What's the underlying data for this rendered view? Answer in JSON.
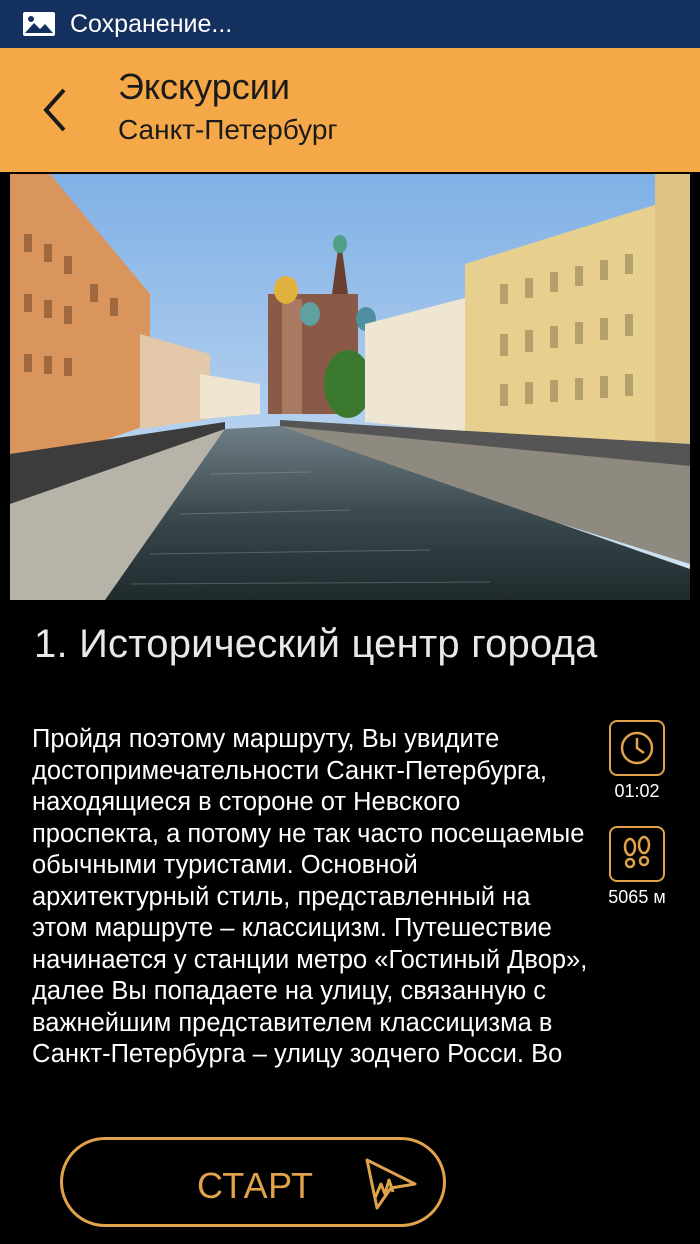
{
  "status_bar": {
    "icon": "image-icon",
    "text": "Сохранение..."
  },
  "app_bar": {
    "title": "Экскурсии",
    "subtitle": "Санкт-Петербург",
    "back_icon": "chevron-left-icon",
    "background": "#f5a847"
  },
  "route": {
    "title": "1. Исторический центр города",
    "description": "Пройдя поэтому маршруту, Вы увидите достопримечательности Санкт-Петербурга, находящиеся в стороне от Невского проспекта, а потому не так часто посещаемые обычными туристами. Основной архитектурный стиль, представленный на этом маршруте – классицизм. Путешествие начинается у станции метро «Гостиный Двор», далее Вы попадаете на улицу, связанную с важнейшим представителем классицизма в Санкт-Петербурга – улицу зодчего Росси. Во",
    "duration": "01:02",
    "distance": "5065 м",
    "duration_icon": "clock-icon",
    "distance_icon": "footprints-icon"
  },
  "actions": {
    "start_label": "СТАРТ",
    "start_icon": "walk-cursor-icon",
    "accent": "#e0a24a"
  }
}
